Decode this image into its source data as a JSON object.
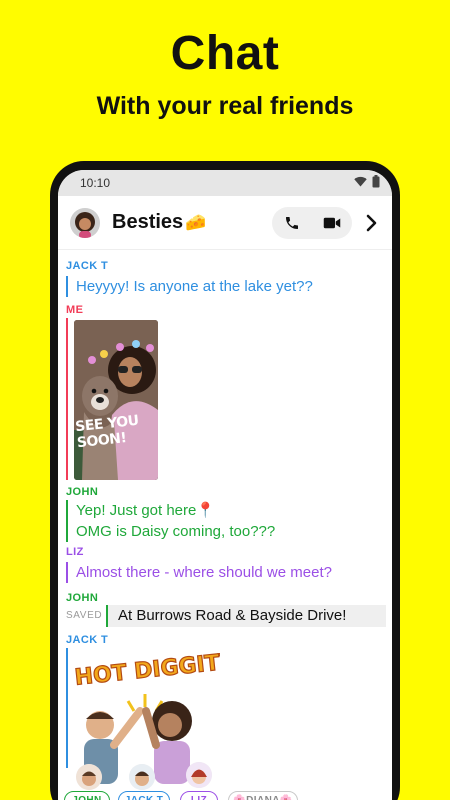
{
  "promo": {
    "title": "Chat",
    "subtitle": "With your real friends"
  },
  "status_bar": {
    "time": "10:10"
  },
  "header": {
    "chat_name": "Besties",
    "chat_emoji": "🧀"
  },
  "messages": [
    {
      "sender": "JACK T",
      "text": "Heyyyy! Is anyone at the lake yet??"
    },
    {
      "sender": "ME",
      "photo_caption": "SEE YOU SOON!"
    },
    {
      "sender": "JOHN",
      "lines": [
        "Yep! Just got here📍",
        "OMG is Daisy coming, too???"
      ]
    },
    {
      "sender": "LIZ",
      "text": "Almost there - where should we meet?"
    },
    {
      "sender": "JOHN",
      "saved_label": "SAVED",
      "text": "At Burrows Road & Bayside Drive!"
    },
    {
      "sender": "JACK T",
      "sticker_text": "HOT DIGGITY"
    }
  ],
  "typing": [
    {
      "name": "JOHN"
    },
    {
      "name": "JACK T"
    },
    {
      "name": "LIZ"
    },
    {
      "name": "🌸DIANA🌸"
    }
  ],
  "colors": {
    "background": "#FFFC00",
    "jack": "#2F8FE0",
    "me": "#F23C57",
    "john": "#1FA83A",
    "liz": "#9B4FE6"
  },
  "icons": [
    "phone-icon",
    "video-icon",
    "chevron-right-icon",
    "wifi-icon",
    "battery-icon"
  ]
}
